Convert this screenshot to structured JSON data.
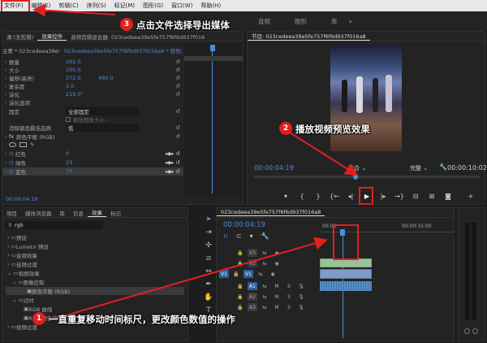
{
  "menu": [
    "文件(F)",
    "编辑(E)",
    "剪辑(C)",
    "序列(S)",
    "标记(M)",
    "图形(G)",
    "窗口(W)",
    "帮助(H)"
  ],
  "workspace_tabs": [
    "音频",
    "图形",
    "库"
  ],
  "effect_controls": {
    "tabs": [
      "源:(无剪辑)",
      "效果控件",
      "音频剪辑混合器: 023cedeea39e5fe757f6f6d937f016a8"
    ],
    "master": "主要 * 023cedeea39e5fe757f6f6d937f016a8",
    "clip": "023cedeea39e5fe757f6f6d937f016a8 * 颜色遮罩",
    "props": [
      {
        "label": "数量",
        "v1": "292.0",
        "v2": ""
      },
      {
        "label": "大小",
        "v1": "100.0",
        "v2": ""
      },
      {
        "label": "偏移(高亮)",
        "v1": "272.0",
        "v2": "480.0"
      },
      {
        "label": "复杂度",
        "v1": "1.0",
        "v2": ""
      },
      {
        "label": "演化",
        "v1": "219.0°",
        "v2": ""
      },
      {
        "label": "演化选项",
        "v1": "",
        "v2": ""
      },
      {
        "label": "固定",
        "v1": "全部固定",
        "v2": ""
      },
      {
        "label": "缩放图像大小",
        "v1": "",
        "v2": ""
      },
      {
        "label": "消除锯齿最佳品质",
        "v1": "低",
        "v2": ""
      }
    ],
    "fx_name": "颜色平衡 (RGB)",
    "rgb": [
      {
        "label": "红色",
        "value": "0"
      },
      {
        "label": "绿色",
        "value": "23"
      },
      {
        "label": "蓝色",
        "value": "77"
      }
    ],
    "timecode": "00:00:04:19"
  },
  "program": {
    "title": "节目: 023cedeea39e5fe757f6f6d937f016a8",
    "timecode": "00:00:04:19",
    "fit": "适合",
    "quality": "完整",
    "duration": "00:00:10:02"
  },
  "project": {
    "tabs": [
      "项目",
      "媒体浏览器",
      "库",
      "信息",
      "效果",
      "标记"
    ],
    "search": "rgb",
    "items": [
      "预设",
      "Lumetri 预设",
      "音频效果",
      "音频过渡",
      "视频效果",
      "图像控制",
      "颜色平衡 (RGB)",
      "过时",
      "RGB 曲线",
      "RGB 颜色校正器",
      "视频过渡"
    ]
  },
  "timeline": {
    "title": "023cedeea39e5fe757f6f6d937f016a8",
    "timecode": "00:00:04:19",
    "ruler": [
      "00:00",
      "00:00:15:00"
    ],
    "tracks": [
      "V3",
      "V2",
      "V1",
      "A1",
      "A2",
      "A3"
    ]
  },
  "annotations": {
    "a1": "一直重复移动时间标尺，更改颜色数值的操作",
    "a2": "播放视频预览效果",
    "a3": "点击文件选择导出媒体",
    "n1": "1",
    "n2": "2",
    "n3": "3"
  },
  "colors": {
    "accent": "#4f8dd6",
    "highlight": "#e02020",
    "clip_video": "#9ac29a",
    "clip_audio": "#5a8fc8"
  }
}
